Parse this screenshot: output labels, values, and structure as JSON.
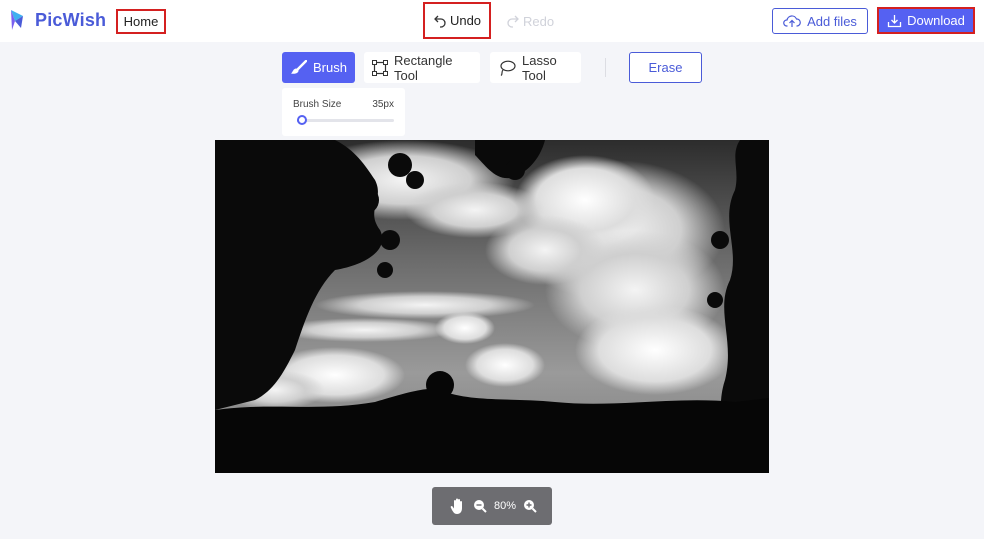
{
  "app": {
    "name": "PicWish",
    "brand_color": "#4a5bd8",
    "accent": "#5561f2",
    "highlight_border": "#d42020"
  },
  "header": {
    "home_label": "Home",
    "undo_label": "Undo",
    "redo_label": "Redo",
    "add_files_label": "Add files",
    "download_label": "Download"
  },
  "toolbar": {
    "tools": [
      {
        "label": "Brush",
        "icon": "brush-icon",
        "active": true
      },
      {
        "label": "Rectangle Tool",
        "icon": "rectangle-select-icon",
        "active": false
      },
      {
        "label": "Lasso Tool",
        "icon": "lasso-icon",
        "active": false
      }
    ],
    "erase_label": "Erase"
  },
  "brush_panel": {
    "label": "Brush Size",
    "value": "35px",
    "slider_fraction": 0.05
  },
  "canvas": {
    "description_icon": "image-preview"
  },
  "zoom": {
    "level": "80%",
    "icons": [
      "hand-icon",
      "zoom-out-icon",
      "zoom-in-icon"
    ]
  }
}
